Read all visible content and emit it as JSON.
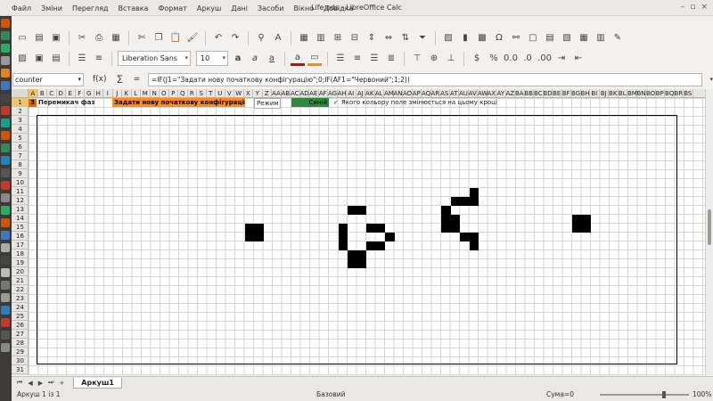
{
  "window": {
    "title": "Life.ods - LibreOffice Calc"
  },
  "menubar": [
    "Файл",
    "Зміни",
    "Перегляд",
    "Вставка",
    "Формат",
    "Аркуш",
    "Дані",
    "Засоби",
    "Вікно",
    "Довідка"
  ],
  "toolbar": {
    "font_name": "Liberation Sans",
    "font_size": "10",
    "currency_symbol": "$",
    "percent_symbol": "%",
    "number_label": "0.0"
  },
  "formula_bar": {
    "name_box": "counter",
    "fx_label": "f(x)",
    "sum_label": "∑",
    "equal_label": "=",
    "formula": "=IF(J1=\"Задати нову початкову конфігурацію\";0;IF(AF1=\"Червоний\";1;2))"
  },
  "columns": [
    "A",
    "B",
    "C",
    "D",
    "E",
    "F",
    "G",
    "H",
    "I",
    "J",
    "K",
    "L",
    "M",
    "N",
    "O",
    "P",
    "Q",
    "R",
    "S",
    "T",
    "U",
    "V",
    "W",
    "X",
    "Y",
    "Z",
    "AA",
    "AB",
    "AC",
    "AD",
    "AE",
    "AF",
    "AG",
    "AH",
    "AI",
    "AJ",
    "AK",
    "AL",
    "AM",
    "AN",
    "AO",
    "AP",
    "AQ",
    "AR",
    "AS",
    "AT",
    "AU",
    "AV",
    "AW",
    "AX",
    "AY",
    "AZ",
    "BA",
    "BB",
    "BC",
    "BD",
    "BE",
    "BF",
    "BG",
    "BH",
    "BI",
    "BJ",
    "BK",
    "BL",
    "BM",
    "BN",
    "BO",
    "BP",
    "BQ",
    "BR",
    "BS"
  ],
  "rows": [
    "1",
    "2",
    "3",
    "4",
    "5",
    "6",
    "7",
    "8",
    "9",
    "10",
    "11",
    "12",
    "13",
    "14",
    "15",
    "16",
    "17",
    "18",
    "19",
    "20",
    "21",
    "22",
    "23",
    "24",
    "25",
    "26",
    "27",
    "28",
    "29",
    "30",
    "31"
  ],
  "row1": {
    "counter_value": "3",
    "phase_switch": "Перемикач фаз",
    "new_config": "Задати нову початкову конфігурацію",
    "mode_label": "Режим",
    "color_label": "Синій",
    "checkbox_label": "Якого кольору поле змінюється на цьому кроці"
  },
  "colors": {
    "counter_bg": "#e06a00",
    "new_config_bg": "#ff8c1a",
    "color_bg": "#2e8b3d",
    "live_cell": "#000000"
  },
  "live_cells": [
    [
      23,
      15
    ],
    [
      23,
      16
    ],
    [
      24,
      15
    ],
    [
      24,
      16
    ],
    [
      34,
      13
    ],
    [
      35,
      13
    ],
    [
      33,
      15
    ],
    [
      33,
      16
    ],
    [
      33,
      17
    ],
    [
      36,
      15
    ],
    [
      37,
      15
    ],
    [
      37,
      17
    ],
    [
      36,
      17
    ],
    [
      38,
      16
    ],
    [
      34,
      18
    ],
    [
      35,
      18
    ],
    [
      34,
      19
    ],
    [
      35,
      19
    ],
    [
      44,
      13
    ],
    [
      44,
      14
    ],
    [
      44,
      15
    ],
    [
      45,
      14
    ],
    [
      45,
      15
    ],
    [
      45,
      12
    ],
    [
      46,
      12
    ],
    [
      46,
      16
    ],
    [
      47,
      11
    ],
    [
      47,
      12
    ],
    [
      47,
      16
    ],
    [
      47,
      17
    ],
    [
      58,
      14
    ],
    [
      58,
      15
    ],
    [
      59,
      14
    ],
    [
      59,
      15
    ]
  ],
  "sheet_tabs": {
    "nav": [
      "⏮",
      "◀",
      "▶",
      "⏭",
      "+"
    ],
    "active_tab": "Аркуш1"
  },
  "status_bar": {
    "sheet_info": "Аркуш 1 із 1",
    "page_style": "Базовий",
    "sum": "Сума=0",
    "zoom": "100%"
  }
}
